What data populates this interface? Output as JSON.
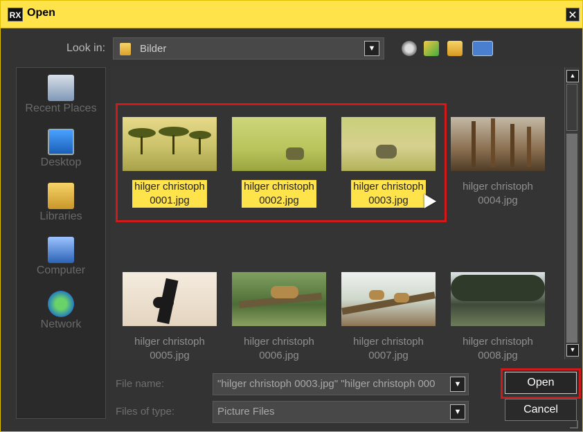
{
  "window": {
    "title": "Open",
    "app_logo": "RX",
    "close_label": "✕"
  },
  "toolbar": {
    "lookin_label": "Look in:",
    "lookin_value": "Bilder",
    "icons": [
      "back-icon",
      "up-folder-icon",
      "new-folder-icon",
      "views-menu-icon"
    ]
  },
  "places": [
    {
      "label": "Recent Places",
      "icon": "recent-places-icon"
    },
    {
      "label": "Desktop",
      "icon": "desktop-icon"
    },
    {
      "label": "Libraries",
      "icon": "libraries-icon"
    },
    {
      "label": "Computer",
      "icon": "computer-icon"
    },
    {
      "label": "Network",
      "icon": "network-icon"
    }
  ],
  "files": [
    {
      "line1": "hilger christoph",
      "line2": "0001.jpg",
      "selected": true
    },
    {
      "line1": "hilger christoph",
      "line2": "0002.jpg",
      "selected": true
    },
    {
      "line1": "hilger christoph",
      "line2": "0003.jpg",
      "selected": true,
      "focused": true
    },
    {
      "line1": "hilger christoph",
      "line2": "0004.jpg",
      "selected": false
    },
    {
      "line1": "hilger christoph",
      "line2": "0005.jpg",
      "selected": false
    },
    {
      "line1": "hilger christoph",
      "line2": "0006.jpg",
      "selected": false
    },
    {
      "line1": "hilger christoph",
      "line2": "0007.jpg",
      "selected": false
    },
    {
      "line1": "hilger christoph",
      "line2": "0008.jpg",
      "selected": false
    }
  ],
  "footer": {
    "filename_label": "File name:",
    "filename_value": "\"hilger christoph 0003.jpg\" \"hilger christoph 000",
    "filetype_label": "Files of type:",
    "filetype_value": "Picture Files",
    "open_label": "Open",
    "cancel_label": "Cancel"
  },
  "colors": {
    "selection": "#ffe34a",
    "highlight_box": "#d21919",
    "title_bar": "#ffe34a"
  }
}
